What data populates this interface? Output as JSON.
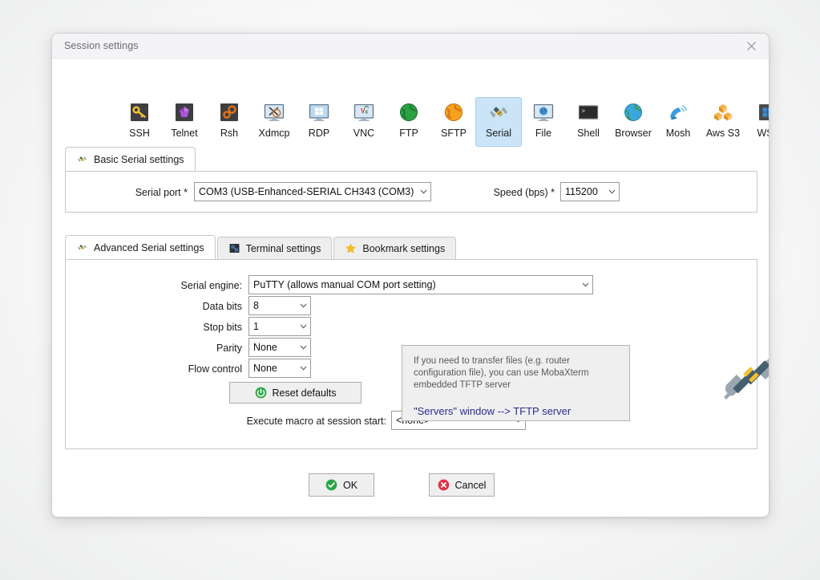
{
  "window": {
    "title": "Session settings",
    "close_icon": "close-icon"
  },
  "session_types": [
    {
      "label": "SSH",
      "icon": "ssh-key-icon",
      "selected": false
    },
    {
      "label": "Telnet",
      "icon": "telnet-gem-icon",
      "selected": false
    },
    {
      "label": "Rsh",
      "icon": "rsh-gears-icon",
      "selected": false
    },
    {
      "label": "Xdmcp",
      "icon": "xdmcp-monitor-icon",
      "selected": false
    },
    {
      "label": "RDP",
      "icon": "rdp-monitor-icon",
      "selected": false
    },
    {
      "label": "VNC",
      "icon": "vnc-monitor-icon",
      "selected": false
    },
    {
      "label": "FTP",
      "icon": "ftp-globe-icon",
      "selected": false
    },
    {
      "label": "SFTP",
      "icon": "sftp-globe-icon",
      "selected": false
    },
    {
      "label": "Serial",
      "icon": "serial-plug-icon",
      "selected": true
    },
    {
      "label": "File",
      "icon": "file-monitor-icon",
      "selected": false
    },
    {
      "label": "Shell",
      "icon": "shell-console-icon",
      "selected": false
    },
    {
      "label": "Browser",
      "icon": "browser-globe-icon",
      "selected": false
    },
    {
      "label": "Mosh",
      "icon": "mosh-satellite-icon",
      "selected": false
    },
    {
      "label": "Aws S3",
      "icon": "aws-s3-cubes-icon",
      "selected": false
    },
    {
      "label": "WSL",
      "icon": "wsl-windows-icon",
      "selected": false
    }
  ],
  "basic": {
    "tab_label": "Basic Serial settings",
    "tab_icon": "serial-plug-icon",
    "serial_port_label": "Serial port *",
    "serial_port_value": "COM3  (USB-Enhanced-SERIAL CH343 (COM3)",
    "speed_label": "Speed (bps) *",
    "speed_value": "115200"
  },
  "advanced": {
    "tabs": [
      {
        "label": "Advanced Serial settings",
        "icon": "serial-plug-icon",
        "active": true
      },
      {
        "label": "Terminal settings",
        "icon": "terminal-icon",
        "active": false
      },
      {
        "label": "Bookmark settings",
        "icon": "star-icon",
        "active": false
      }
    ],
    "serial_engine_label": "Serial engine:",
    "serial_engine_value": "PuTTY   (allows manual COM port setting)",
    "data_bits_label": "Data bits",
    "data_bits_value": "8",
    "stop_bits_label": "Stop bits",
    "stop_bits_value": "1",
    "parity_label": "Parity",
    "parity_value": "None",
    "flow_control_label": "Flow control",
    "flow_control_value": "None",
    "reset_label": "Reset defaults",
    "reset_icon": "reset-circle-icon",
    "macro_label": "Execute macro at session start:",
    "macro_value": "<none>",
    "info_text": "If you need to transfer files (e.g. router configuration file), you can use MobaXterm embedded TFTP server",
    "info_link": "\"Servers\" window  -->  TFTP server",
    "illustration_icon": "serial-plug-large-icon"
  },
  "footer": {
    "ok_label": "OK",
    "ok_icon": "check-circle-icon",
    "cancel_label": "Cancel",
    "cancel_icon": "x-circle-icon"
  }
}
